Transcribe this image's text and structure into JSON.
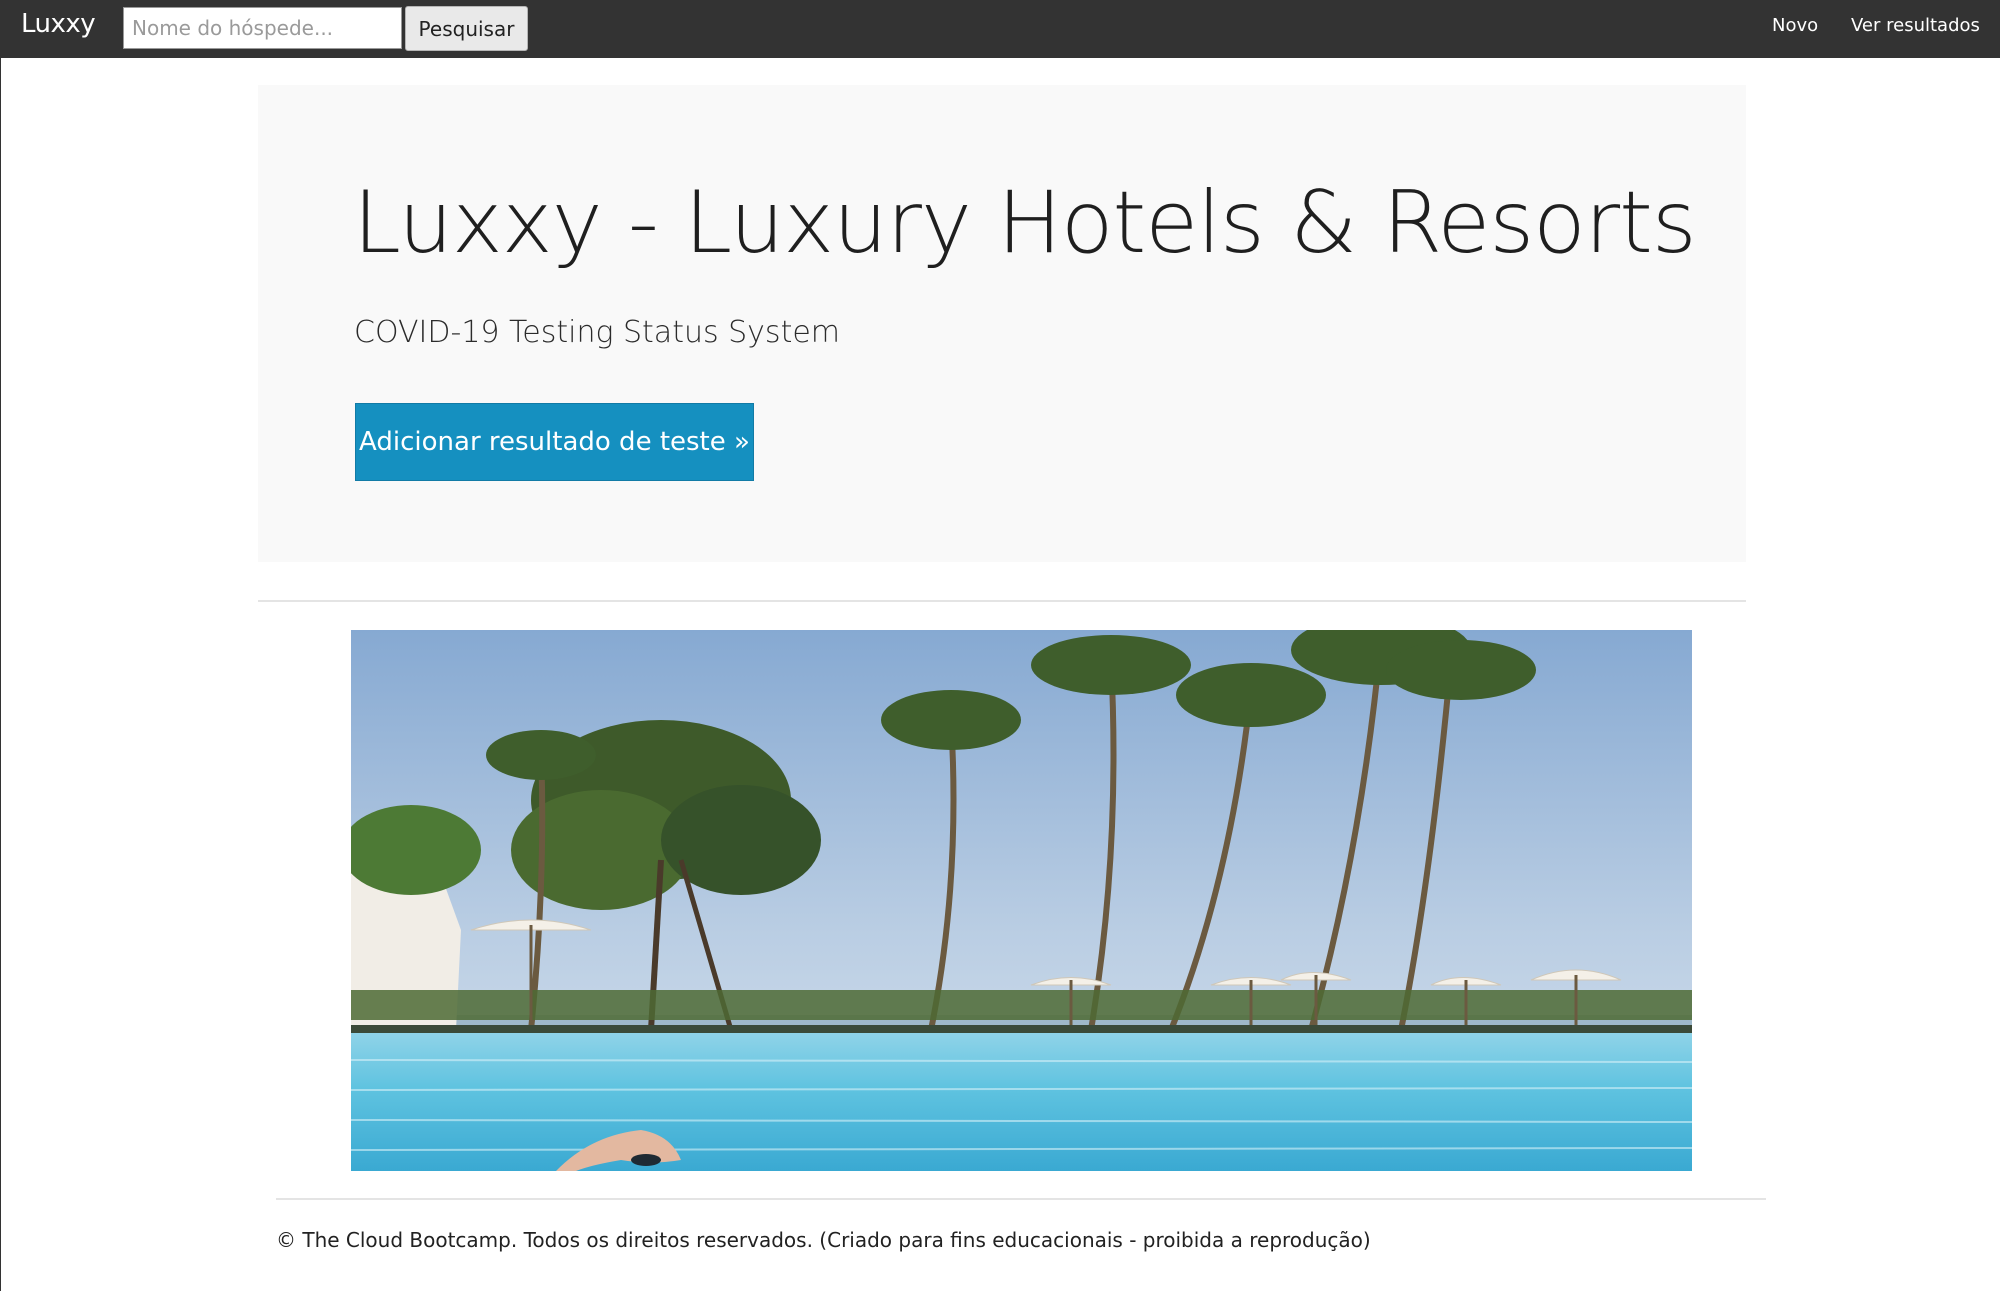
{
  "navbar": {
    "brand": "Luxxy",
    "search_placeholder": "Nome do hóspede...",
    "search_button": "Pesquisar",
    "links": [
      "Novo",
      "Ver resultados"
    ]
  },
  "hero": {
    "title": "Luxxy - Luxury Hotels & Resorts",
    "subtitle": "COVID-19 Testing Status System",
    "cta_label": "Adicionar resultado de teste »"
  },
  "footer": {
    "text": "© The Cloud Bootcamp. Todos os direitos reservados. (Criado para fins educacionais - proibida a reprodução)"
  },
  "colors": {
    "navbar_bg": "#333333",
    "jumbotron_bg": "#f9f9f9",
    "cta_bg": "#1590c0",
    "divider": "#e4e4e4"
  }
}
